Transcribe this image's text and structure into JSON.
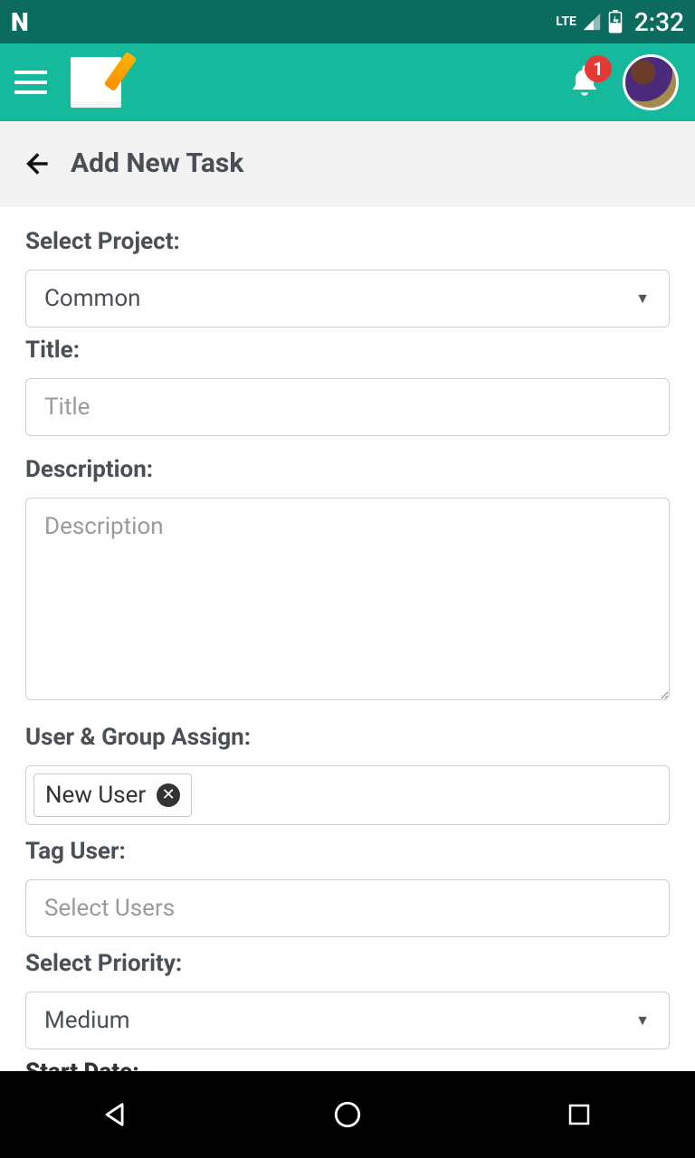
{
  "status": {
    "carrier_icon": "N",
    "network": "LTE",
    "time": "2:32"
  },
  "appbar": {
    "notification_count": "1"
  },
  "header": {
    "title": "Add New Task"
  },
  "form": {
    "project_label": "Select Project:",
    "project_value": "Common",
    "title_label": "Title:",
    "title_placeholder": "Title",
    "title_value": "",
    "description_label": "Description:",
    "description_placeholder": "Description",
    "description_value": "",
    "assign_label": "User & Group Assign:",
    "assign_chips": [
      "New User"
    ],
    "tag_label": "Tag User:",
    "tag_placeholder": "Select Users",
    "priority_label": "Select Priority:",
    "priority_value": "Medium",
    "start_date_label_partial": "Start Date:"
  }
}
